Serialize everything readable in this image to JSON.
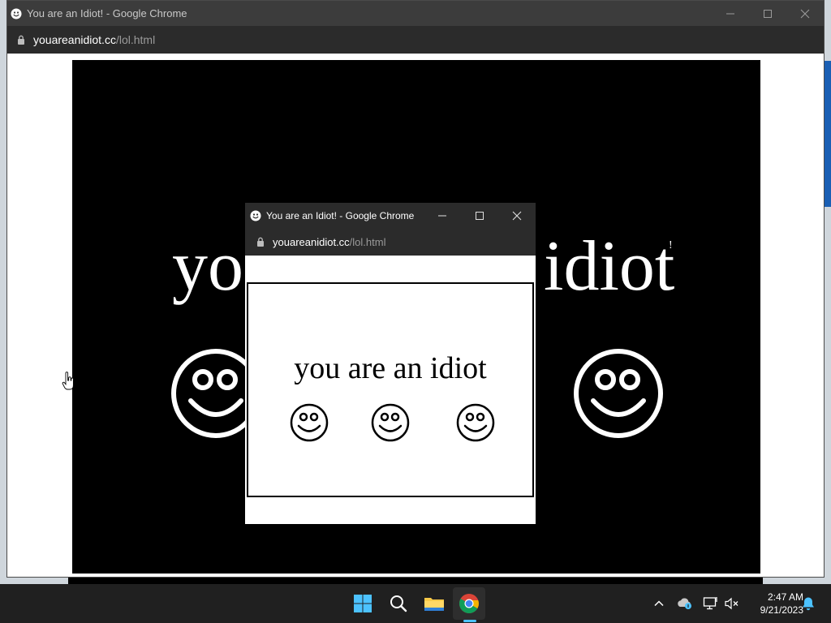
{
  "main_window": {
    "title": "You are an Idiot! - Google Chrome",
    "url_host": "youareanidiot.cc",
    "url_path": "/lol.html",
    "page_text_left": "yo",
    "page_text_right": "idiot",
    "page_text_punct": "!"
  },
  "popup_window": {
    "title": "You are an Idiot! - Google Chrome",
    "url_host": "youareanidiot.cc",
    "url_path": "/lol.html",
    "page_text": "you are an idiot"
  },
  "taskbar": {
    "icons": [
      "windows-start-icon",
      "search-icon",
      "file-explorer-icon",
      "chrome-icon"
    ],
    "tray_icons": [
      "chevron-up-icon",
      "onedrive-icon",
      "network-icon",
      "volume-muted-icon",
      "notification-bell-icon"
    ],
    "time": "2:47 AM",
    "date": "9/21/2023"
  },
  "colors": {
    "titlebar": "#3c3c3c",
    "addressbar": "#2b2b2b",
    "taskbar": "#202020",
    "accent": "#4cc2ff"
  }
}
